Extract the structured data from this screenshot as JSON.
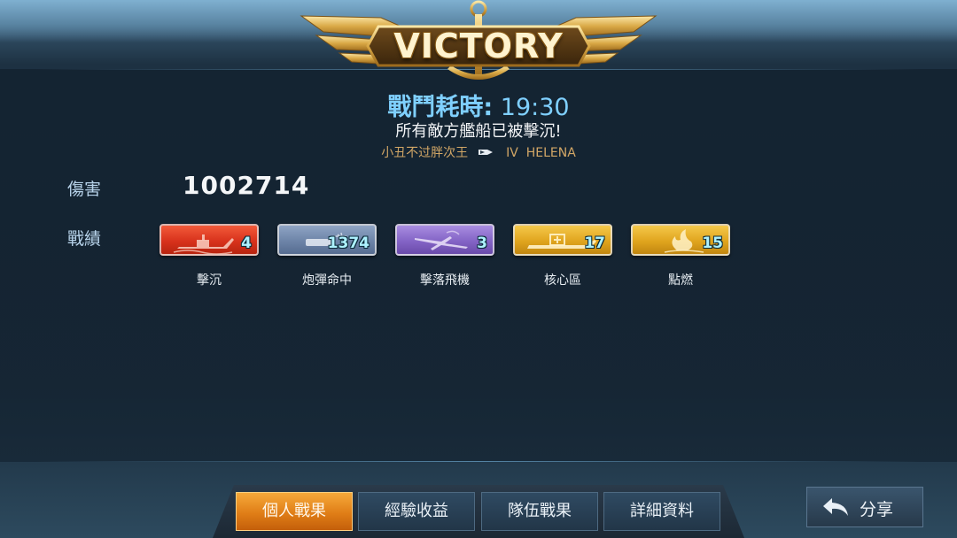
{
  "header": {
    "title": "VICTORY",
    "duration_label": "戰鬥耗時:",
    "duration_value": "19:30",
    "result_message": "所有敵方艦船已被擊沉!",
    "player_name": "小丑不过胖次王",
    "ship_tier": "IV",
    "ship_name": "HELENA"
  },
  "stats": {
    "damage_label": "傷害",
    "damage_value": "1002714",
    "achievements_label": "戰績"
  },
  "medals": [
    {
      "label": "擊沉",
      "count": "4",
      "icon": "sinking-ship-icon",
      "color": "#d8321c"
    },
    {
      "label": "炮彈命中",
      "count": "1374",
      "icon": "shell-hit-icon",
      "color": "#6d84a8"
    },
    {
      "label": "擊落飛機",
      "count": "3",
      "icon": "plane-shot-down-icon",
      "color": "#8464c6"
    },
    {
      "label": "核心區",
      "count": "17",
      "icon": "citadel-icon",
      "color": "#e0a51e"
    },
    {
      "label": "點燃",
      "count": "15",
      "icon": "fire-icon",
      "color": "#e0a51e"
    }
  ],
  "tabs": [
    {
      "label": "個人戰果",
      "active": true
    },
    {
      "label": "經驗收益",
      "active": false
    },
    {
      "label": "隊伍戰果",
      "active": false
    },
    {
      "label": "詳細資料",
      "active": false
    }
  ],
  "share": {
    "label": "分享",
    "icon": "back-arrow-icon"
  }
}
